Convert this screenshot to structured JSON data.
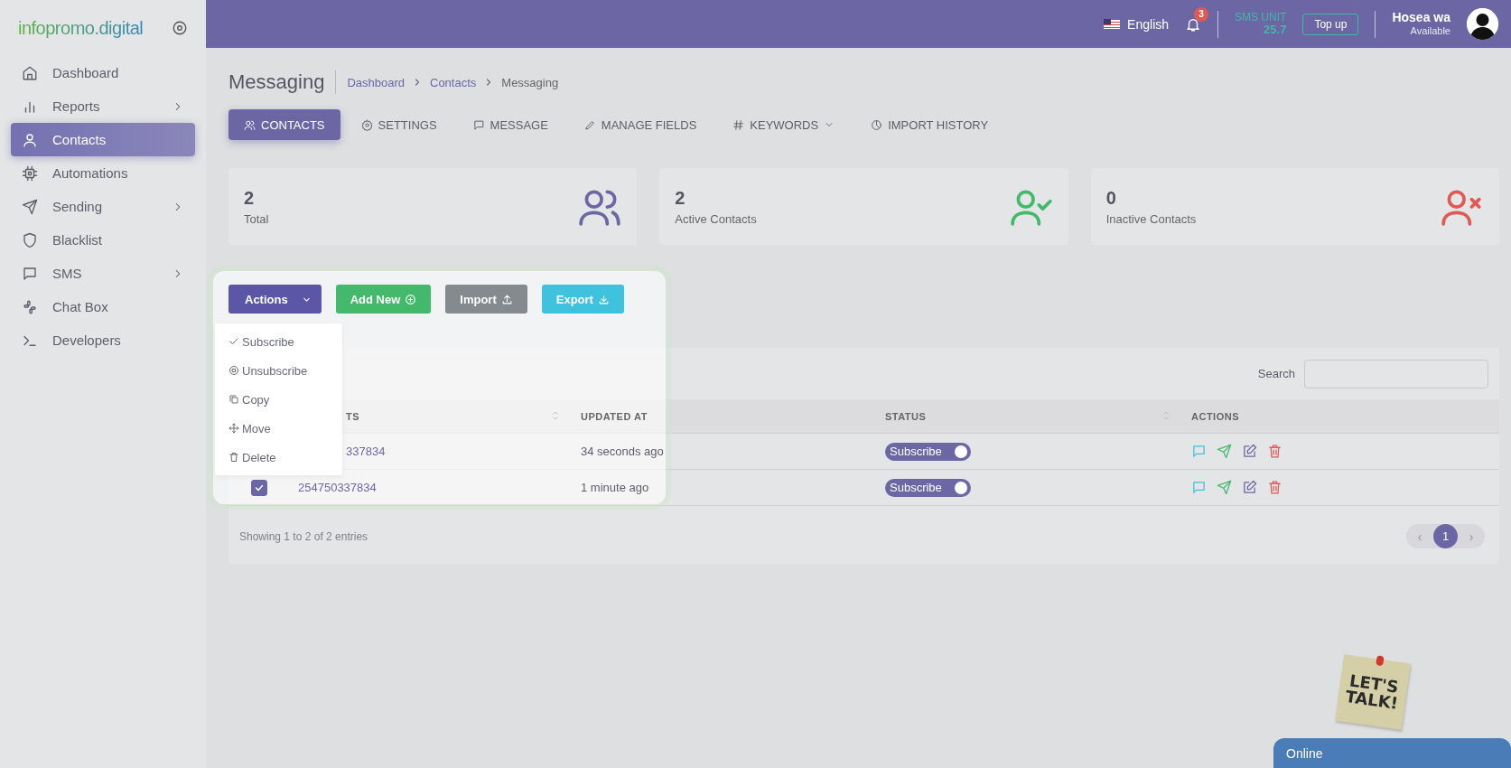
{
  "sidebar": {
    "logo": "infopromo.digital",
    "items": [
      {
        "label": "Dashboard",
        "has_submenu": false,
        "selected": false
      },
      {
        "label": "Reports",
        "has_submenu": true,
        "selected": false
      },
      {
        "label": "Contacts",
        "has_submenu": false,
        "selected": true
      },
      {
        "label": "Automations",
        "has_submenu": false,
        "selected": false
      },
      {
        "label": "Sending",
        "has_submenu": true,
        "selected": false
      },
      {
        "label": "Blacklist",
        "has_submenu": false,
        "selected": false
      },
      {
        "label": "SMS",
        "has_submenu": true,
        "selected": false
      },
      {
        "label": "Chat Box",
        "has_submenu": false,
        "selected": false
      },
      {
        "label": "Developers",
        "has_submenu": false,
        "selected": false
      }
    ]
  },
  "topbar": {
    "language": "English",
    "notification_count": "3",
    "sms_unit_label": "SMS UNIT",
    "sms_unit_value": "25.7",
    "topup_button": "Top up",
    "user_name": "Hosea wa",
    "user_status": "Available"
  },
  "page": {
    "title": "Messaging",
    "breadcrumbs": [
      "Dashboard",
      "Contacts",
      "Messaging"
    ]
  },
  "tabs": [
    {
      "label": "CONTACTS",
      "selected": true,
      "has_dropdown": false
    },
    {
      "label": "SETTINGS",
      "selected": false,
      "has_dropdown": false
    },
    {
      "label": "MESSAGE",
      "selected": false,
      "has_dropdown": false
    },
    {
      "label": "MANAGE FIELDS",
      "selected": false,
      "has_dropdown": false
    },
    {
      "label": "KEYWORDS",
      "selected": false,
      "has_dropdown": true
    },
    {
      "label": "IMPORT HISTORY",
      "selected": false,
      "has_dropdown": false
    }
  ],
  "stats": [
    {
      "value": "2",
      "label": "Total",
      "kind": "total"
    },
    {
      "value": "2",
      "label": "Active Contacts",
      "kind": "active"
    },
    {
      "value": "0",
      "label": "Inactive Contacts",
      "kind": "inactive"
    }
  ],
  "toolbar": {
    "buttons": [
      {
        "label": "Actions",
        "kind": "actions"
      },
      {
        "label": "Add New",
        "kind": "add"
      },
      {
        "label": "Import",
        "kind": "import"
      },
      {
        "label": "Export",
        "kind": "export"
      }
    ],
    "menu": [
      {
        "label": "Subscribe",
        "kind": "subscribe"
      },
      {
        "label": "Unsubscribe",
        "kind": "unsubscribe"
      },
      {
        "label": "Copy",
        "kind": "copy"
      },
      {
        "label": "Move",
        "kind": "move"
      },
      {
        "label": "Delete",
        "kind": "delete"
      }
    ]
  },
  "table": {
    "search_label": "Search",
    "columns": [
      {
        "label": "TS",
        "sortable": true
      },
      {
        "label": "UPDATED AT",
        "sortable": false
      },
      {
        "label": "STATUS",
        "sortable": true
      },
      {
        "label": "ACTIONS",
        "sortable": false
      }
    ],
    "rows": [
      {
        "contact": "337834",
        "updated_at": "34 seconds ago",
        "status": "Subscribe",
        "on": true
      },
      {
        "checked": true,
        "contact": "254750337834",
        "updated_at": "1 minute ago",
        "status": "Subscribe",
        "on": true
      }
    ],
    "footer": "Showing 1 to 2 of 2 entries",
    "pagination": {
      "prev": "‹",
      "pages": [
        {
          "label": "1",
          "selected": true
        }
      ],
      "next": "›"
    }
  },
  "chat_widget": {
    "sticker_line_1": "LET'S",
    "sticker_line_2": "TALK!",
    "status": "Online"
  }
}
